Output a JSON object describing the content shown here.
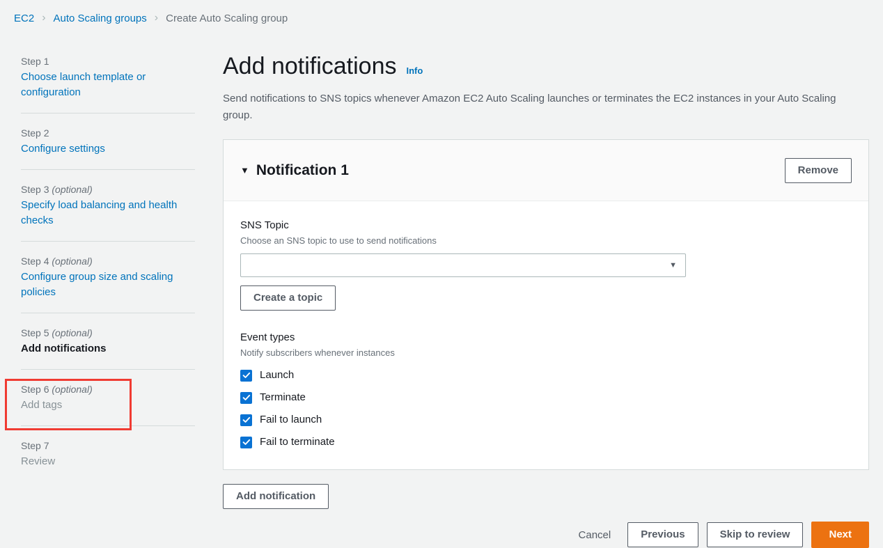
{
  "breadcrumb": {
    "items": [
      {
        "label": "EC2",
        "type": "link"
      },
      {
        "label": "Auto Scaling groups",
        "type": "link"
      },
      {
        "label": "Create Auto Scaling group",
        "type": "current"
      }
    ],
    "separator": "›"
  },
  "sidebar": {
    "steps": [
      {
        "num": "Step 1",
        "optional": "",
        "title": "Choose launch template or configuration",
        "state": "link"
      },
      {
        "num": "Step 2",
        "optional": "",
        "title": "Configure settings",
        "state": "link"
      },
      {
        "num": "Step 3",
        "optional": "(optional)",
        "title": "Specify load balancing and health checks",
        "state": "link"
      },
      {
        "num": "Step 4",
        "optional": "(optional)",
        "title": "Configure group size and scaling policies",
        "state": "link"
      },
      {
        "num": "Step 5",
        "optional": "(optional)",
        "title": "Add notifications",
        "state": "active"
      },
      {
        "num": "Step 6",
        "optional": "(optional)",
        "title": "Add tags",
        "state": "disabled"
      },
      {
        "num": "Step 7",
        "optional": "",
        "title": "Review",
        "state": "disabled"
      }
    ],
    "highlight_color": "#f03b32"
  },
  "main": {
    "title": "Add notifications",
    "info_label": "Info",
    "description": "Send notifications to SNS topics whenever Amazon EC2 Auto Scaling launches or terminates the EC2 instances in your Auto Scaling group.",
    "notification": {
      "collapse_icon": "▼",
      "title": "Notification 1",
      "remove_label": "Remove",
      "sns_topic": {
        "label": "SNS Topic",
        "description": "Choose an SNS topic to use to send notifications",
        "selected_value": "",
        "placeholder": "",
        "dropdown_icon": "▼"
      },
      "create_topic_label": "Create a topic",
      "event_types": {
        "label": "Event types",
        "description": "Notify subscribers whenever instances",
        "options": [
          {
            "label": "Launch",
            "checked": true
          },
          {
            "label": "Terminate",
            "checked": true
          },
          {
            "label": "Fail to launch",
            "checked": true
          },
          {
            "label": "Fail to terminate",
            "checked": true
          }
        ]
      }
    },
    "add_notification_label": "Add notification",
    "actions": {
      "cancel": "Cancel",
      "previous": "Previous",
      "skip": "Skip to review",
      "next": "Next"
    }
  },
  "colors": {
    "accent_orange": "#ec7211",
    "link_blue": "#0073bb",
    "checkbox_blue": "#0972d3",
    "highlight_red": "#f03b32",
    "page_background": "#f2f3f3"
  }
}
